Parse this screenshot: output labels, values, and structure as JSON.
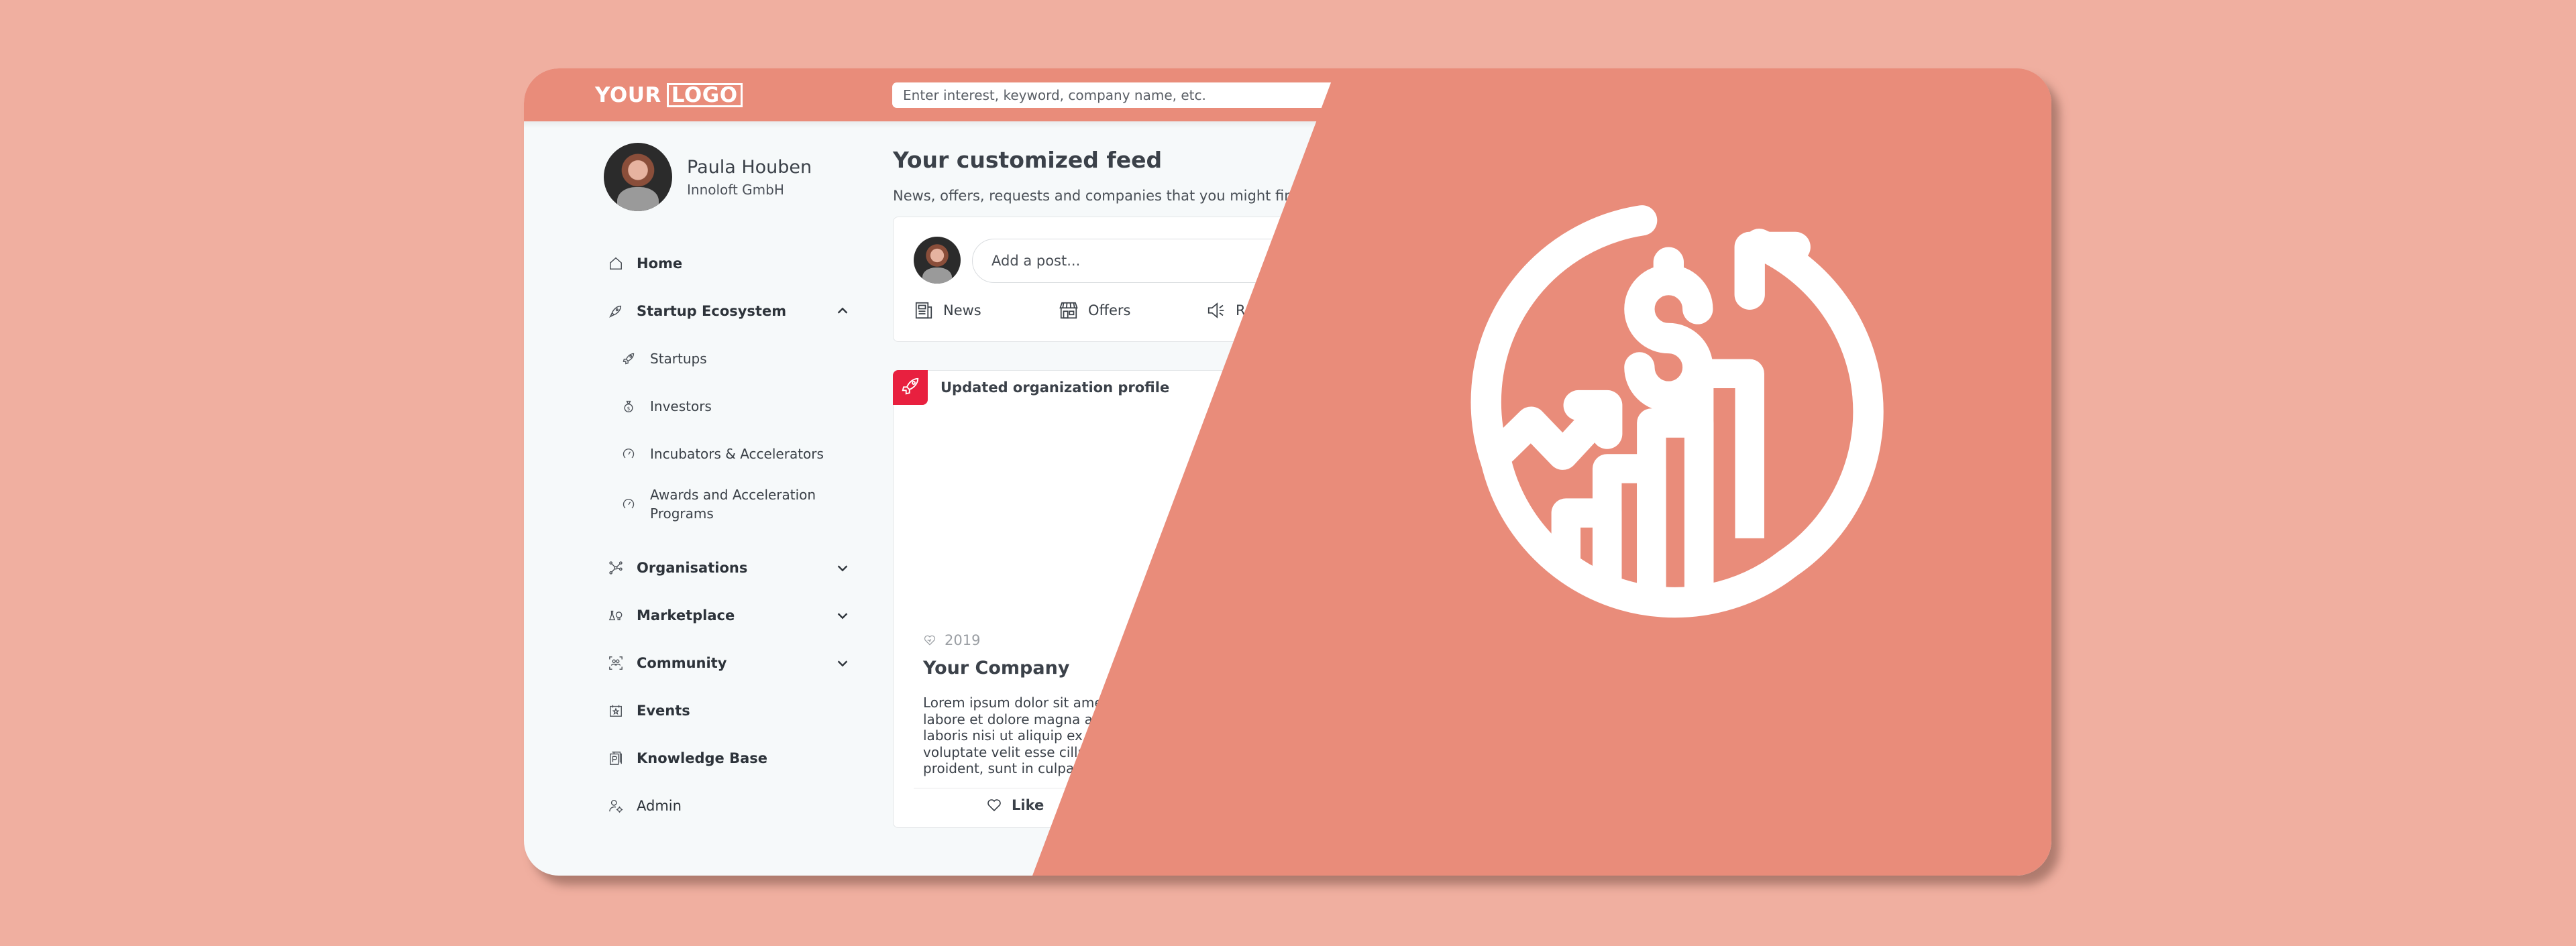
{
  "colors": {
    "background": "#F0AFA0",
    "accent": "#E98C7A",
    "badge": "#E8203F",
    "panel": "#F6F9FA"
  },
  "header": {
    "logo_word_1": "YOUR",
    "logo_word_2": "LOGO",
    "search_placeholder": "Enter interest, keyword, company name, etc."
  },
  "profile": {
    "name": "Paula Houben",
    "organization": "Innoloft GmbH"
  },
  "sidebar": {
    "items": [
      {
        "label": "Home",
        "icon": "home-icon"
      },
      {
        "label": "Startup Ecosystem",
        "icon": "rocket-icon",
        "expanded": true
      },
      {
        "label": "Startups",
        "icon": "rocket-outline-icon",
        "sub": true
      },
      {
        "label": "Investors",
        "icon": "money-bag-icon",
        "sub": true
      },
      {
        "label": "Incubators & Accelerators",
        "icon": "speedometer-icon",
        "sub": true
      },
      {
        "label": "Awards and Acceleration Programs",
        "icon": "speedometer-icon",
        "sub": true
      },
      {
        "label": "Organisations",
        "icon": "network-icon",
        "expanded": false
      },
      {
        "label": "Marketplace",
        "icon": "lab-bulb-icon",
        "expanded": false
      },
      {
        "label": "Community",
        "icon": "group-icon",
        "expanded": false
      },
      {
        "label": "Events",
        "icon": "calendar-star-icon"
      },
      {
        "label": "Knowledge Base",
        "icon": "book-icon"
      },
      {
        "label": "Admin",
        "icon": "user-gear-icon"
      }
    ]
  },
  "feed": {
    "title": "Your customized feed",
    "subtitle": "News, offers, requests and companies that you might find",
    "composer": {
      "placeholder": "Add a post...",
      "actions": [
        {
          "label": "News",
          "icon": "newspaper-icon"
        },
        {
          "label": "Offers",
          "icon": "store-icon"
        },
        {
          "label": "R",
          "icon": "megaphone-icon"
        }
      ]
    },
    "post": {
      "heading": "Updated organization profile",
      "badge_icon": "rocket-icon",
      "year": "2019",
      "company": "Your Company",
      "body_lines": [
        "Lorem ipsum dolor sit amet,",
        "labore et dolore magna aliq",
        "laboris nisi ut aliquip ex ea",
        "voluptate velit esse cillum",
        "proident, sunt in culpa qu"
      ],
      "like_label": "Like"
    }
  },
  "hero": {
    "icon": "dollar-growth-globe-icon"
  }
}
